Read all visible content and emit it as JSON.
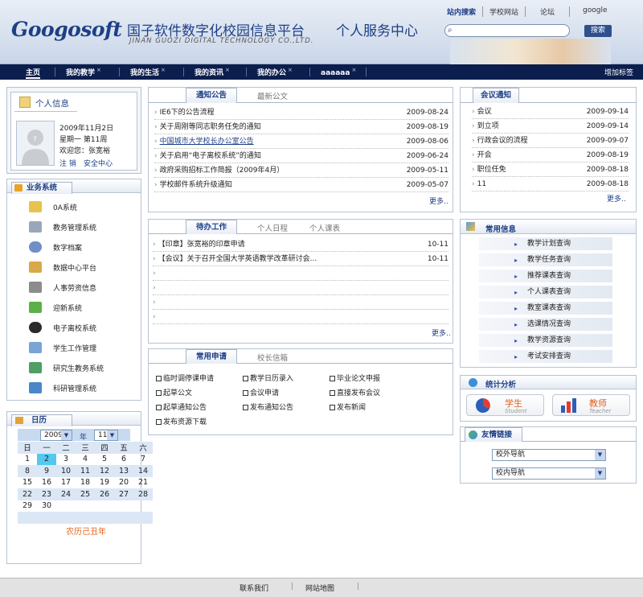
{
  "header": {
    "logo": "Googosoft",
    "site_title": "国子软件数字化校园信息平台",
    "subtitle": "JINAN GUOZI DIGITAL TECHNOLOGY CO.,LTD.",
    "portal_title": "个人服务中心",
    "top_links": [
      "站内搜索",
      "学校网站",
      "论坛",
      "google"
    ],
    "search_button": "搜索"
  },
  "nav": {
    "items": [
      "主页",
      "我的教学",
      "我的生活",
      "我的资讯",
      "我的办公",
      "aaaaaa"
    ],
    "close_mark": "×",
    "add_tab": "增加标签"
  },
  "profile": {
    "title": "个人信息",
    "date": "2009年11月2日",
    "weekday": "星期一 第11周",
    "welcome": "欢迎您：张宽裕",
    "logout": "注 销",
    "security": "安全中心"
  },
  "systems": {
    "title": "业务系统",
    "items": [
      "0A系统",
      "教务管理系统",
      "数字档案",
      "数据中心平台",
      "人事劳资信息",
      "迎新系统",
      "电子离校系统",
      "学生工作管理",
      "研究生教务系统",
      "科研管理系统"
    ]
  },
  "calendar": {
    "title": "日历",
    "year": "2009",
    "year_label": "年",
    "month": "11",
    "weekdays": [
      "日",
      "一",
      "二",
      "三",
      "四",
      "五",
      "六"
    ],
    "weeks": [
      [
        "1",
        "2",
        "3",
        "4",
        "5",
        "6",
        "7"
      ],
      [
        "8",
        "9",
        "10",
        "11",
        "12",
        "13",
        "14"
      ],
      [
        "15",
        "16",
        "17",
        "18",
        "19",
        "20",
        "21"
      ],
      [
        "22",
        "23",
        "24",
        "25",
        "26",
        "27",
        "28"
      ],
      [
        "29",
        "30",
        "",
        "",
        "",
        "",
        ""
      ]
    ],
    "today": "2",
    "lunar": "农历己丑年"
  },
  "notices": {
    "tabs": [
      "通知公告",
      "最新公文"
    ],
    "items": [
      {
        "title": "IE6下的公告流程",
        "date": "2009-08-24"
      },
      {
        "title": "关于周刚等同志职务任免的通知",
        "date": "2009-08-19"
      },
      {
        "title": "中国城市大学校长办公室公告",
        "date": "2009-08-06"
      },
      {
        "title": "关于启用“电子离校系统”的通知",
        "date": "2009-06-24"
      },
      {
        "title": "政府采购招标工作简报（2009年4月）",
        "date": "2009-05-11"
      },
      {
        "title": "学校邮件系统升级通知",
        "date": "2009-05-07"
      }
    ],
    "more": "更多.."
  },
  "todo": {
    "tabs": [
      "待办工作",
      "个人日程",
      "个人课表"
    ],
    "items": [
      {
        "title": "【印章】张宽裕的印章申请",
        "date": "10-11"
      },
      {
        "title": "【会议】关于召开全国大学英语教学改革研讨会...",
        "date": "10-11"
      }
    ],
    "more": "更多.."
  },
  "applications": {
    "tabs": [
      "常用申请",
      "校长信箱"
    ],
    "items": [
      "临时调停课申请",
      "教学日历录入",
      "毕业论文申报",
      "起草公文",
      "会议申请",
      "直接发布会议",
      "起草通知公告",
      "发布通知公告",
      "发布新闻",
      "发布资源下载"
    ]
  },
  "meetings": {
    "title": "会议通知",
    "items": [
      {
        "title": "会议",
        "date": "2009-09-14"
      },
      {
        "title": "到立项",
        "date": "2009-09-14"
      },
      {
        "title": "行政会议的流程",
        "date": "2009-09-07"
      },
      {
        "title": "开会",
        "date": "2009-08-19"
      },
      {
        "title": "职位任免",
        "date": "2009-08-18"
      },
      {
        "title": "11",
        "date": "2009-08-18"
      }
    ],
    "more": "更多.."
  },
  "common_info": {
    "title": "常用信息",
    "items": [
      "教学计划查询",
      "教学任务查询",
      "推荐课表查询",
      "个人课表查询",
      "教室课表查询",
      "选课情况查询",
      "教学资源查询",
      "考试安排查询"
    ]
  },
  "stats": {
    "title": "统计分析",
    "student": "学生",
    "student_en": "Student",
    "teacher": "教师",
    "teacher_en": "Teacher"
  },
  "links": {
    "title": "友情链接",
    "selects": [
      "校外导航",
      "校内导航"
    ]
  },
  "footer": {
    "items": [
      "联系我们",
      "网站地图"
    ]
  },
  "colors": {
    "brand": "#1d3f86",
    "nav_bg": "#0b1e4d",
    "today_bg": "#55c8ef"
  }
}
